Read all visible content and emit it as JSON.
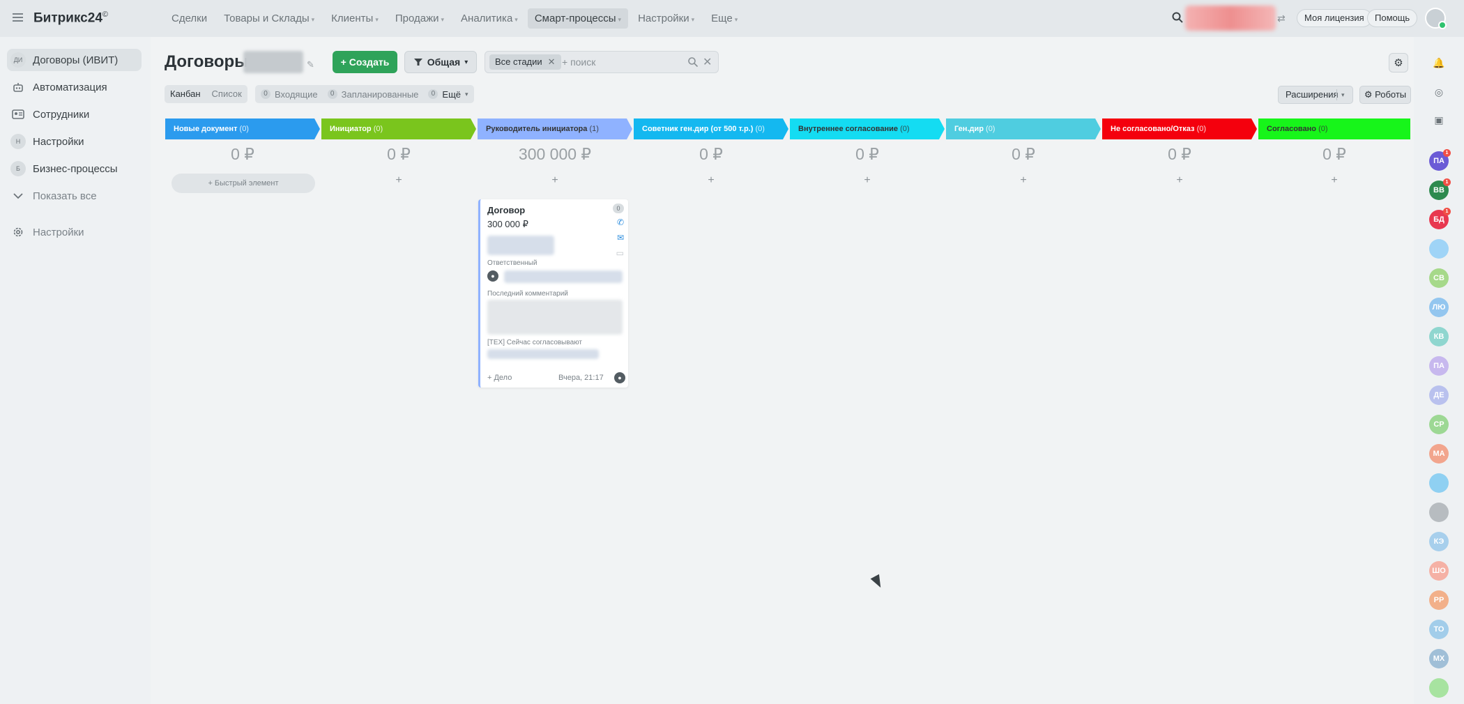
{
  "app": {
    "logo": "Битрикс24",
    "logo_mark": "©"
  },
  "topnav": [
    {
      "label": "Сделки",
      "chevron": false,
      "active": false
    },
    {
      "label": "Товары и Склады",
      "chevron": true,
      "active": false
    },
    {
      "label": "Клиенты",
      "chevron": true,
      "active": false
    },
    {
      "label": "Продажи",
      "chevron": true,
      "active": false
    },
    {
      "label": "Аналитика",
      "chevron": true,
      "active": false
    },
    {
      "label": "Смарт-процессы",
      "chevron": true,
      "active": true
    },
    {
      "label": "Настройки",
      "chevron": true,
      "active": false
    },
    {
      "label": "Еще",
      "chevron": true,
      "active": false
    }
  ],
  "top_actions": {
    "license": "Моя лицензия",
    "help": "Помощь"
  },
  "sidebar": {
    "items": [
      {
        "label": "Договоры (ИВИТ)",
        "badge": "ДИ",
        "active": true
      },
      {
        "label": "Автоматизация",
        "badge": "",
        "active": false
      },
      {
        "label": "Сотрудники",
        "badge": "",
        "active": false
      },
      {
        "label": "Настройки",
        "badge": "Н",
        "active": false
      },
      {
        "label": "Бизнес-процессы",
        "badge": "Б",
        "active": false
      },
      {
        "label": "Показать все",
        "badge": "",
        "active": false
      }
    ],
    "settings": "Настройки"
  },
  "toolbar": {
    "title": "Договоры",
    "create_label": "Создать",
    "filter_label": "Общая",
    "search_tag": "Все стадии",
    "search_placeholder": "+ поиск"
  },
  "views": {
    "kanban": "Канбан",
    "list": "Список"
  },
  "counters": [
    {
      "num": "0",
      "label": "Входящие"
    },
    {
      "num": "0",
      "label": "Запланированные"
    },
    {
      "num": "0",
      "label": "Ещё"
    }
  ],
  "extensions_label": "Расширения",
  "robots_label": "Роботы",
  "colors": {
    "stage_new": "#2b9bee",
    "stage_initiator": "#7ac51d",
    "stage_head": "#8fb2ff",
    "stage_advisor": "#14b8f0",
    "stage_internal": "#14dcf2",
    "stage_gendir": "#4fcde0",
    "stage_rejected": "#f4000d",
    "stage_approved": "#17f51a",
    "create_button": "#2fa35a"
  },
  "stages": [
    {
      "name": "Новые документ",
      "count": "(0)",
      "sum": "0 ₽",
      "color": "#2b9bee"
    },
    {
      "name": "Инициатор",
      "count": "(0)",
      "sum": "0 ₽",
      "color": "#7ac51d"
    },
    {
      "name": "Руководитель инициатора",
      "count": "(1)",
      "sum": "300 000 ₽",
      "color": "#8fb2ff"
    },
    {
      "name": "Советник ген.дир (от 500 т.р.)",
      "count": "(0)",
      "sum": "0 ₽",
      "color": "#14b8f0"
    },
    {
      "name": "Внутреннее согласование",
      "count": "(0)",
      "sum": "0 ₽",
      "color": "#14dcf2"
    },
    {
      "name": "Ген.дир",
      "count": "(0)",
      "sum": "0 ₽",
      "color": "#4fcde0"
    },
    {
      "name": "Не согласовано/Отказ",
      "count": "(0)",
      "sum": "0 ₽",
      "color": "#f4000d"
    },
    {
      "name": "Согласовано",
      "count": "(0)",
      "sum": "0 ₽",
      "color": "#17f51a"
    }
  ],
  "quick_add": "+ Быстрый элемент",
  "add_symbol": "+",
  "card": {
    "title": "Договор",
    "sum": "300 000 ₽",
    "badge": "0",
    "responsible_label": "Ответственный",
    "last_comment_label": "Последний комментарий",
    "tech_label": "[ТЕХ] Сейчас согласовывают",
    "add_deal": "+ Дело",
    "date": "Вчера, 21:17"
  },
  "right_avatars": [
    {
      "initials": "ПА",
      "color": "#6b5bd6",
      "notify": "1"
    },
    {
      "initials": "ВВ",
      "color": "#2d8a4e",
      "notify": "1"
    },
    {
      "initials": "БД",
      "color": "#e8384f",
      "notify": "1"
    },
    {
      "initials": "",
      "color": "#9fd4f7",
      "notify": ""
    },
    {
      "initials": "СВ",
      "color": "#a6d98a",
      "notify": ""
    },
    {
      "initials": "ЛЮ",
      "color": "#93c6ef",
      "notify": ""
    },
    {
      "initials": "КВ",
      "color": "#8fd6cf",
      "notify": ""
    },
    {
      "initials": "ПА",
      "color": "#c7b8ee",
      "notify": ""
    },
    {
      "initials": "ДЕ",
      "color": "#b9c1ee",
      "notify": ""
    },
    {
      "initials": "СР",
      "color": "#9dd894",
      "notify": ""
    },
    {
      "initials": "МА",
      "color": "#f2a58d",
      "notify": ""
    },
    {
      "initials": "",
      "color": "#8fd0f2",
      "notify": ""
    },
    {
      "initials": "",
      "color": "#b7bcc0",
      "notify": ""
    },
    {
      "initials": "КЭ",
      "color": "#a7cfec",
      "notify": ""
    },
    {
      "initials": "ШО",
      "color": "#f5b1a5",
      "notify": ""
    },
    {
      "initials": "РР",
      "color": "#f2b08a",
      "notify": ""
    },
    {
      "initials": "ТО",
      "color": "#a2cdea",
      "notify": ""
    },
    {
      "initials": "МХ",
      "color": "#a0bfd7",
      "notify": ""
    },
    {
      "initials": "",
      "color": "#a7e3a0",
      "notify": ""
    }
  ]
}
